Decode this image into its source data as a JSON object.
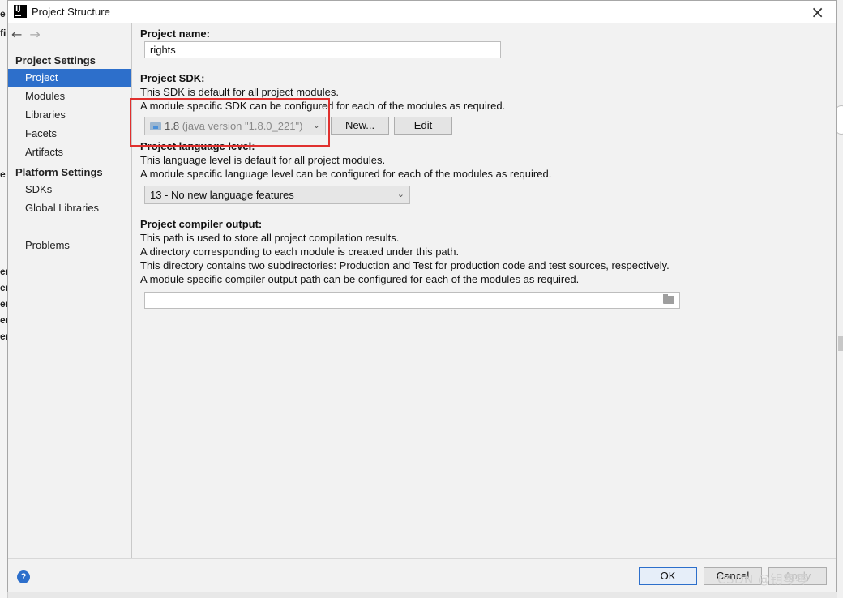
{
  "window": {
    "title": "Project Structure",
    "app_icon_text": "IJ",
    "close_glyph": "×"
  },
  "nav": {
    "back_glyph": "←",
    "forward_glyph": "→"
  },
  "sidebar": {
    "project_settings_heading": "Project Settings",
    "platform_settings_heading": "Platform Settings",
    "items": [
      {
        "label": "Project"
      },
      {
        "label": "Modules"
      },
      {
        "label": "Libraries"
      },
      {
        "label": "Facets"
      },
      {
        "label": "Artifacts"
      },
      {
        "label": "SDKs"
      },
      {
        "label": "Global Libraries"
      },
      {
        "label": "Problems"
      }
    ]
  },
  "project_name": {
    "label": "Project name:",
    "value": "rights"
  },
  "project_sdk": {
    "label": "Project SDK:",
    "desc1": "This SDK is default for all project modules.",
    "desc2": "A module specific SDK can be configured for each of the modules as required.",
    "selected": "1.8",
    "version": "(java version \"1.8.0_221\")",
    "new_button": "New...",
    "edit_button": "Edit"
  },
  "language_level": {
    "label": "Project language level:",
    "desc1": "This language level is default for all project modules.",
    "desc2": "A module specific language level can be configured for each of the modules as required.",
    "selected": "13 - No new language features"
  },
  "compiler_output": {
    "label": "Project compiler output:",
    "desc1": "This path is used to store all project compilation results.",
    "desc2": "A directory corresponding to each module is created under this path.",
    "desc3": "This directory contains two subdirectories: Production and Test for production code and test sources, respectively.",
    "desc4": "A module specific compiler output path can be configured for each of the modules as required.",
    "value": ""
  },
  "footer": {
    "help_glyph": "?",
    "ok_button": "OK",
    "cancel_button": "Cancel",
    "apply_button": "Apply"
  },
  "watermark": "CSDN @钥零零",
  "colors": {
    "selection": "#2d6fcb",
    "annotation_box": "#e0302e"
  },
  "icons": [
    "back-arrow-icon",
    "forward-arrow-icon",
    "close-icon",
    "folder-icon",
    "chevron-down-icon",
    "browse-folder-icon",
    "help-icon"
  ]
}
